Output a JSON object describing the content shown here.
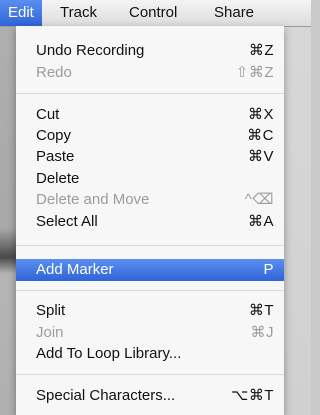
{
  "menubar": {
    "items": [
      {
        "label": "Edit"
      },
      {
        "label": "Track"
      },
      {
        "label": "Control"
      },
      {
        "label": "Share"
      }
    ]
  },
  "menu": {
    "items": [
      {
        "label": "Undo Recording",
        "shortcut": "⌘Z",
        "disabled": false
      },
      {
        "label": "Redo",
        "shortcut": "⇧⌘Z",
        "disabled": true
      },
      {
        "label": "Cut",
        "shortcut": "⌘X",
        "disabled": false
      },
      {
        "label": "Copy",
        "shortcut": "⌘C",
        "disabled": false
      },
      {
        "label": "Paste",
        "shortcut": "⌘V",
        "disabled": false
      },
      {
        "label": "Delete",
        "shortcut": "",
        "disabled": false
      },
      {
        "label": "Delete and Move",
        "shortcut": "^⌫",
        "disabled": true
      },
      {
        "label": "Select All",
        "shortcut": "⌘A",
        "disabled": false
      },
      {
        "label": "Add Marker",
        "shortcut": "P",
        "disabled": false,
        "highlighted": true
      },
      {
        "label": "Split",
        "shortcut": "⌘T",
        "disabled": false
      },
      {
        "label": "Join",
        "shortcut": "⌘J",
        "disabled": true
      },
      {
        "label": "Add To Loop Library...",
        "shortcut": "",
        "disabled": false
      },
      {
        "label": "Special Characters...",
        "shortcut": "⌥⌘T",
        "disabled": false
      }
    ]
  }
}
